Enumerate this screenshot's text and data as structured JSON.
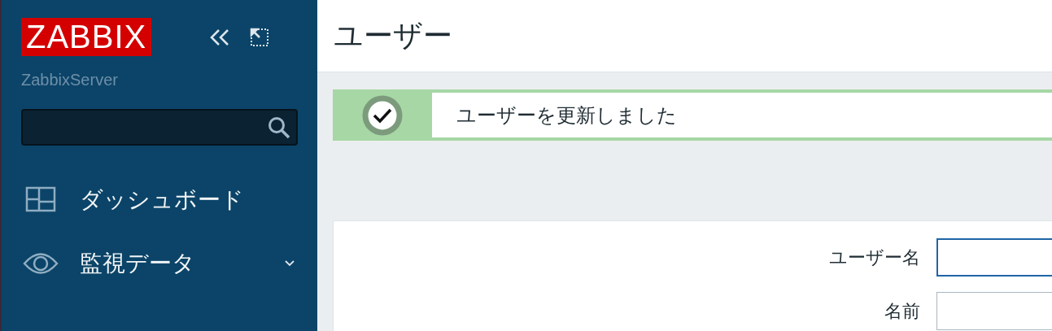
{
  "sidebar": {
    "logo": "ZABBIX",
    "server": "ZabbixServer",
    "items": [
      {
        "label": "ダッシュボード",
        "kind": "dashboard",
        "expandable": false
      },
      {
        "label": "監視データ",
        "kind": "monitoring",
        "expandable": true
      }
    ]
  },
  "page": {
    "title": "ユーザー"
  },
  "message": {
    "text": "ユーザーを更新しました",
    "kind": "success"
  },
  "form": {
    "fields": [
      {
        "label": "ユーザー名",
        "focused": true
      },
      {
        "label": "名前",
        "focused": false
      }
    ]
  }
}
